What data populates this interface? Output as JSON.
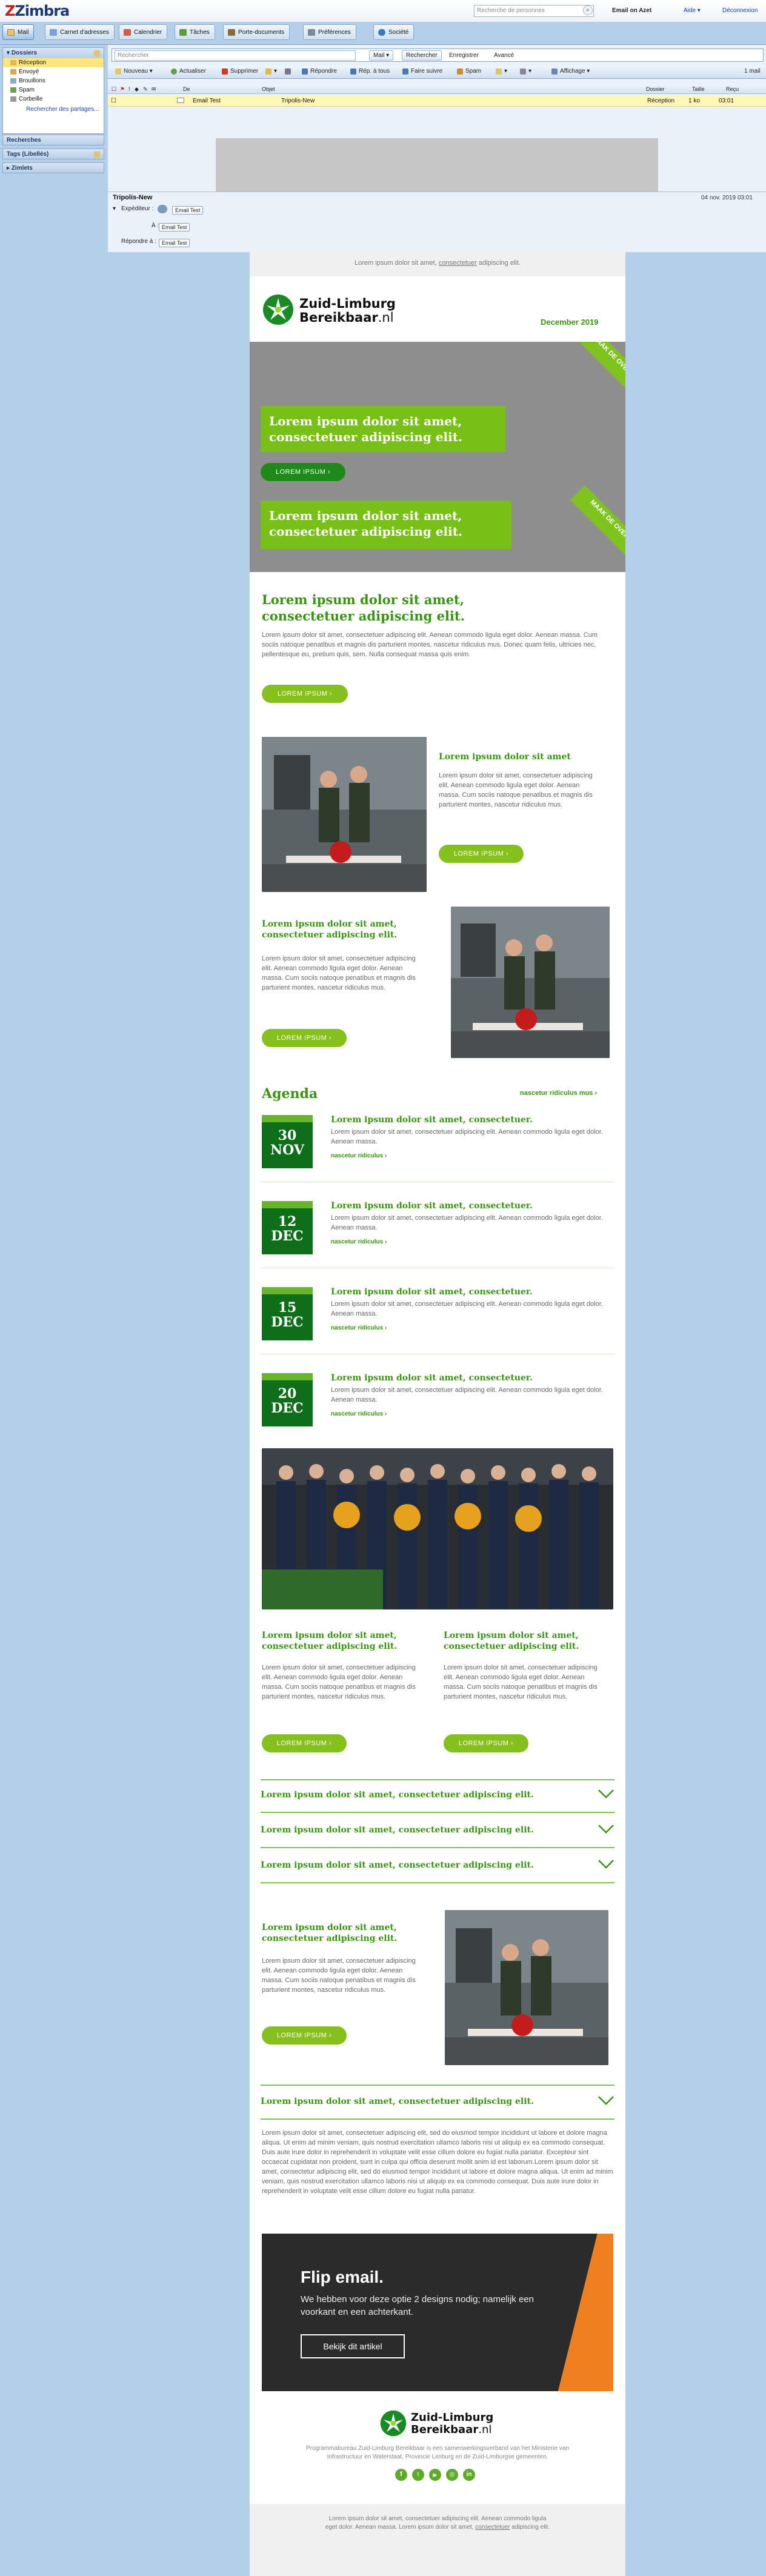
{
  "app": {
    "logo_text": "Zimbra"
  },
  "top": {
    "search_placeholder": "Recherche de personnes",
    "user": "Email on Azet",
    "help": "Aide",
    "logout": "Déconnexion"
  },
  "tabs": [
    "Mail",
    "Carnet d'adresses",
    "Calendrier",
    "Tâches",
    "Porte-documents",
    "Préférences",
    "Société"
  ],
  "sidebar": {
    "folders_title": "Dossiers",
    "folders": [
      "Réception",
      "Envoyé",
      "Brouillons",
      "Spam",
      "Corbeille"
    ],
    "search_shared": "Rechercher des partages...",
    "searches": "Recherches",
    "tags": "Tags (Libellés)",
    "zimlets": "Zimlets"
  },
  "toolbar": {
    "search_placeholder": "Rechercher",
    "mail": "Mail",
    "search_btn": "Rechercher",
    "save": "Enregistrer",
    "advanced": "Avancé"
  },
  "actions": [
    "Nouveau",
    "Actualiser",
    "Supprimer",
    "Répondre",
    "Rép. à tous",
    "Faire suivre",
    "Spam",
    "Affichage"
  ],
  "page_count": "1 mail",
  "columns": [
    "De",
    "Objet",
    "Dossier",
    "Taille",
    "Reçu"
  ],
  "message": {
    "from": "Email Test",
    "subject": "Tripolis-New",
    "folder": "Réception",
    "size": "1 ko",
    "time": "03:01"
  },
  "reading": {
    "subject": "Tripolis-New",
    "date": "04 nov. 2019 03:01",
    "from_label": "Expéditeur :",
    "from": "Email Test",
    "to_label": "À :",
    "to": "Email Test",
    "reply_label": "Répondre à :",
    "reply": "Email Test"
  },
  "newsletter": {
    "preheader_pre": "Lorem ipsum dolor sit amet, ",
    "preheader_link": "consectetuer",
    "preheader_post": " adipiscing elit.",
    "brand_line1": "Zuid-Limburg",
    "brand_line2": "Bereikbaar",
    "brand_tld": ".nl",
    "month": "December 2019",
    "ribbon": "MAAK DE OVERSTAP!",
    "hero_title": "Lorem ipsum dolor sit amet, consectetuer adipiscing elit.",
    "hero_btn": "LOREM IPSUM",
    "hero2_title": "Lorem ipsum dolor sit amet, consectetuer adipiscing elit.",
    "intro_title": "Lorem ipsum dolor sit amet, consectetuer adipiscing elit.",
    "intro_body": "Lorem ipsum dolor sit amet, consectetuer adipiscing elit. Aenean commodo ligula eget dolor. Aenean massa. Cum sociis natoque penatibus et magnis dis parturient montes, nascetur ridiculus mus. Donec quam felis, ultricies nec, pellentesque eu, pretium quis, sem. Nulla consequat massa quis enim.",
    "intro_btn": "LOREM IPSUM",
    "art1_title": "Lorem ipsum dolor sit amet",
    "art1_body": "Lorem ipsum dolor sit amet, consectetuer adipiscing elit. Aenean commodo ligula eget dolor. Aenean massa. Cum sociis natoque penatibus et magnis dis parturient montes, nascetur ridiculus mus.",
    "art1_btn": "LOREM IPSUM",
    "art2_title": "Lorem ipsum dolor sit amet, consectetuer adipiscing elit.",
    "art2_body": "Lorem ipsum dolor sit amet, consectetuer adipiscing elit. Aenean commodo ligula eget dolor. Aenean massa. Cum sociis natoque penatibus et magnis dis parturient montes, nascetur ridiculus mus.",
    "art2_btn": "LOREM IPSUM",
    "agenda_title": "Agenda",
    "agenda_more": "nascetur ridiculus mus",
    "agenda": [
      {
        "day": "30",
        "month": "NOV",
        "title": "Lorem ipsum dolor sit amet, consectetuer.",
        "body": "Lorem ipsum dolor sit amet, consectetuer adipiscing elit. Aenean commodo ligula eget dolor. Aenean massa.",
        "link": "nascetur ridiculus"
      },
      {
        "day": "12",
        "month": "DEC",
        "title": "Lorem ipsum dolor sit amet, consectetuer.",
        "body": "Lorem ipsum dolor sit amet, consectetuer adipiscing elit. Aenean commodo ligula eget dolor. Aenean massa.",
        "link": "nascetur ridiculus"
      },
      {
        "day": "15",
        "month": "DEC",
        "title": "Lorem ipsum dolor sit amet, consectetuer.",
        "body": "Lorem ipsum dolor sit amet, consectetuer adipiscing elit. Aenean commodo ligula eget dolor. Aenean massa.",
        "link": "nascetur ridiculus"
      },
      {
        "day": "20",
        "month": "DEC",
        "title": "Lorem ipsum dolor sit amet, consectetuer.",
        "body": "Lorem ipsum dolor sit amet, consectetuer adipiscing elit. Aenean commodo ligula eget dolor. Aenean massa.",
        "link": "nascetur ridiculus"
      }
    ],
    "col1_title": "Lorem ipsum dolor sit amet, consectetuer adipiscing elit.",
    "col1_body": "Lorem ipsum dolor sit amet, consectetuer adipiscing elit. Aenean commodo ligula eget dolor. Aenean massa. Cum sociis natoque penatibus et magnis dis parturient montes, nascetur ridiculus mus.",
    "col1_btn": "LOREM IPSUM",
    "col2_title": "Lorem ipsum dolor sit amet, consectetuer adipiscing elit.",
    "col2_body": "Lorem ipsum dolor sit amet, consectetuer adipiscing elit. Aenean commodo ligula eget dolor. Aenean massa. Cum sociis natoque penatibus et magnis dis parturient montes, nascetur ridiculus mus.",
    "col2_btn": "LOREM IPSUM",
    "accordion": [
      "Lorem ipsum dolor sit amet, consectetuer adipiscing elit.",
      "Lorem ipsum dolor sit amet, consectetuer adipiscing elit.",
      "Lorem ipsum dolor sit amet, consectetuer adipiscing elit."
    ],
    "art3_title": "Lorem ipsum dolor sit amet, consectetuer adipiscing elit.",
    "art3_body": "Lorem ipsum dolor sit amet, consectetuer adipiscing elit. Aenean commodo ligula eget dolor. Aenean massa. Cum sociis natoque penatibus et magnis dis parturient montes, nascetur ridiculus mus.",
    "art3_btn": "LOREM IPSUM",
    "acc_open_title": "Lorem ipsum dolor sit amet, consectetuer adipiscing elit.",
    "acc_open_body": "Lorem ipsum dolor sit amet, consectetuer adipiscing elit, sed do eiusmod tempor incididunt ut labore et dolore magna aliqua. Ut enim ad minim veniam, quis nostrud exercitation ullamco laboris nisi ut aliquip ex ea commodo consequat. Duis aute irure dolor in reprehenderit in voluptate velit esse cillum dolore eu fugiat nulla pariatur. Excepteur sint occaecat cupidatat non proident, sunt in culpa qui officia deserunt mollit anim id est laborum.Lorem ipsum dolor sit amet, consectetur adipiscing elit, sed do eiusmod tempor incididunt ut labore et dolore magna aliqua. Ut enim ad minim veniam, quis nostrud exercitation ullamco laboris nisi ut aliquip ex ea commodo consequat. Duis aute irure dolor in reprehenderit in voluptate velit esse cillum dolore eu fugiat nulla pariatur.",
    "flip_title": "Flip email.",
    "flip_body": "We hebben voor deze optie 2 designs nodig; namelijk een voorkant en een achterkant.",
    "flip_btn": "Bekijk dit artikel",
    "footer_brand1": "Zuid-Limburg",
    "footer_brand2": "Bereikbaar",
    "footer_tld": ".nl",
    "footer_text": "Programmabureau Zuid-Limburg Bereikbaar is een samenwerkingsverband van het Ministerie van Infrastructuur en Waterstaat, Provincie Limburg en de Zuid-Limburgse gemeenten.",
    "bottom_text": "Lorem ipsum dolor sit amet, consectetuer adipiscing elit. Aenean commodo ligula eget dolor. Aenean massa. Lorem ipsum dolor sit amet,",
    "bottom_link": "consectetuer",
    "bottom_post": " adipiscing elit."
  },
  "colors": {
    "green": "#3a9312",
    "lime": "#86c01c",
    "dark_green": "#0f6e1a",
    "zimbra_blue": "#b4cfe9"
  }
}
